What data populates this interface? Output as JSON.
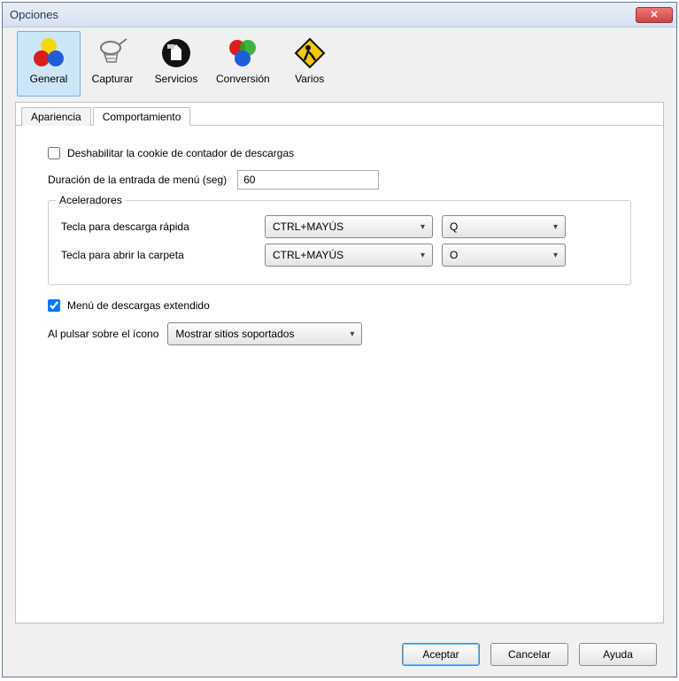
{
  "window": {
    "title": "Opciones"
  },
  "toolbar": {
    "items": [
      {
        "label": "General"
      },
      {
        "label": "Capturar"
      },
      {
        "label": "Servicios"
      },
      {
        "label": "Conversión"
      },
      {
        "label": "Varios"
      }
    ]
  },
  "tabs": {
    "apariencia": "Apariencia",
    "comportamiento": "Comportamiento"
  },
  "form": {
    "disable_cookie_label": "Deshabilitar la cookie de contador de descargas",
    "menu_duration_label": "Duración de la entrada de menú (seg)",
    "menu_duration_value": "60",
    "accelerators_legend": "Aceleradores",
    "quick_download_label": "Tecla para descarga rápida",
    "quick_download_mod": "CTRL+MAYÚS",
    "quick_download_key": "Q",
    "open_folder_label": "Tecla para abrir la carpeta",
    "open_folder_mod": "CTRL+MAYÚS",
    "open_folder_key": "O",
    "extended_menu_label": "Menú de descargas extendido",
    "on_icon_click_label": "Al pulsar sobre el ícono",
    "on_icon_click_value": "Mostrar sitios soportados"
  },
  "buttons": {
    "accept": "Aceptar",
    "cancel": "Cancelar",
    "help": "Ayuda"
  }
}
